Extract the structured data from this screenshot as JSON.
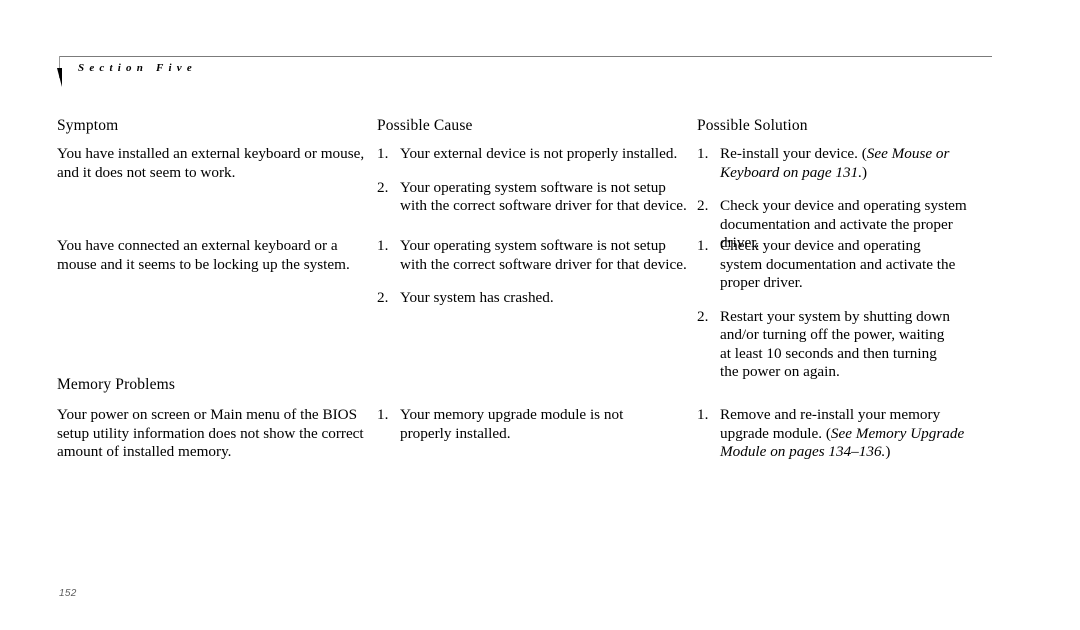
{
  "header": {
    "section_label": "Section Five",
    "rule_color": "#7b7b7b"
  },
  "columns": {
    "symptom_header": "Symptom",
    "cause_header": "Possible Cause",
    "solution_header": "Possible Solution"
  },
  "rows": [
    {
      "symptom": "You have installed an external keyboard or mouse, and it does not seem to work.",
      "causes": [
        {
          "num": "1.",
          "text": "Your external device is not properly installed."
        },
        {
          "num": "2.",
          "text": "Your operating system software is not setup with the correct software driver for that device."
        }
      ],
      "solutions": [
        {
          "num": "1.",
          "text": "Re-install your device. (",
          "italic": "See Mouse or Keyboard on page 131.",
          "tail": ")"
        },
        {
          "num": "2.",
          "text": "Check your device and operating system documentation and activate the proper driver."
        }
      ]
    },
    {
      "symptom": "You have connected an external keyboard or a mouse and it seems to be locking up the system.",
      "causes": [
        {
          "num": "1.",
          "text": "Your operating system software is not setup with the correct software driver for that device."
        },
        {
          "num": "2.",
          "text": "Your system has crashed."
        }
      ],
      "solutions": [
        {
          "num": "1.",
          "text": "Check your device and operating system documentation and activate the proper driver."
        },
        {
          "num": "2.",
          "text": "Restart your system by shutting down and/or turning off the power, waiting at least 10 seconds and then turning the power on again."
        }
      ]
    }
  ],
  "memory_section": {
    "subheading": "Memory Problems",
    "symptom": "Your power on screen or Main menu of the BIOS setup utility information does not show the correct amount of installed memory.",
    "causes": [
      {
        "num": "1.",
        "text": "Your memory upgrade module is not properly installed."
      }
    ],
    "solutions": [
      {
        "num": "1.",
        "text": "Remove and re-install your memory upgrade module. (",
        "italic": "See Memory Upgrade Module on pages 134–136.",
        "tail": ")"
      }
    ]
  },
  "footer": {
    "page_number": "152"
  }
}
